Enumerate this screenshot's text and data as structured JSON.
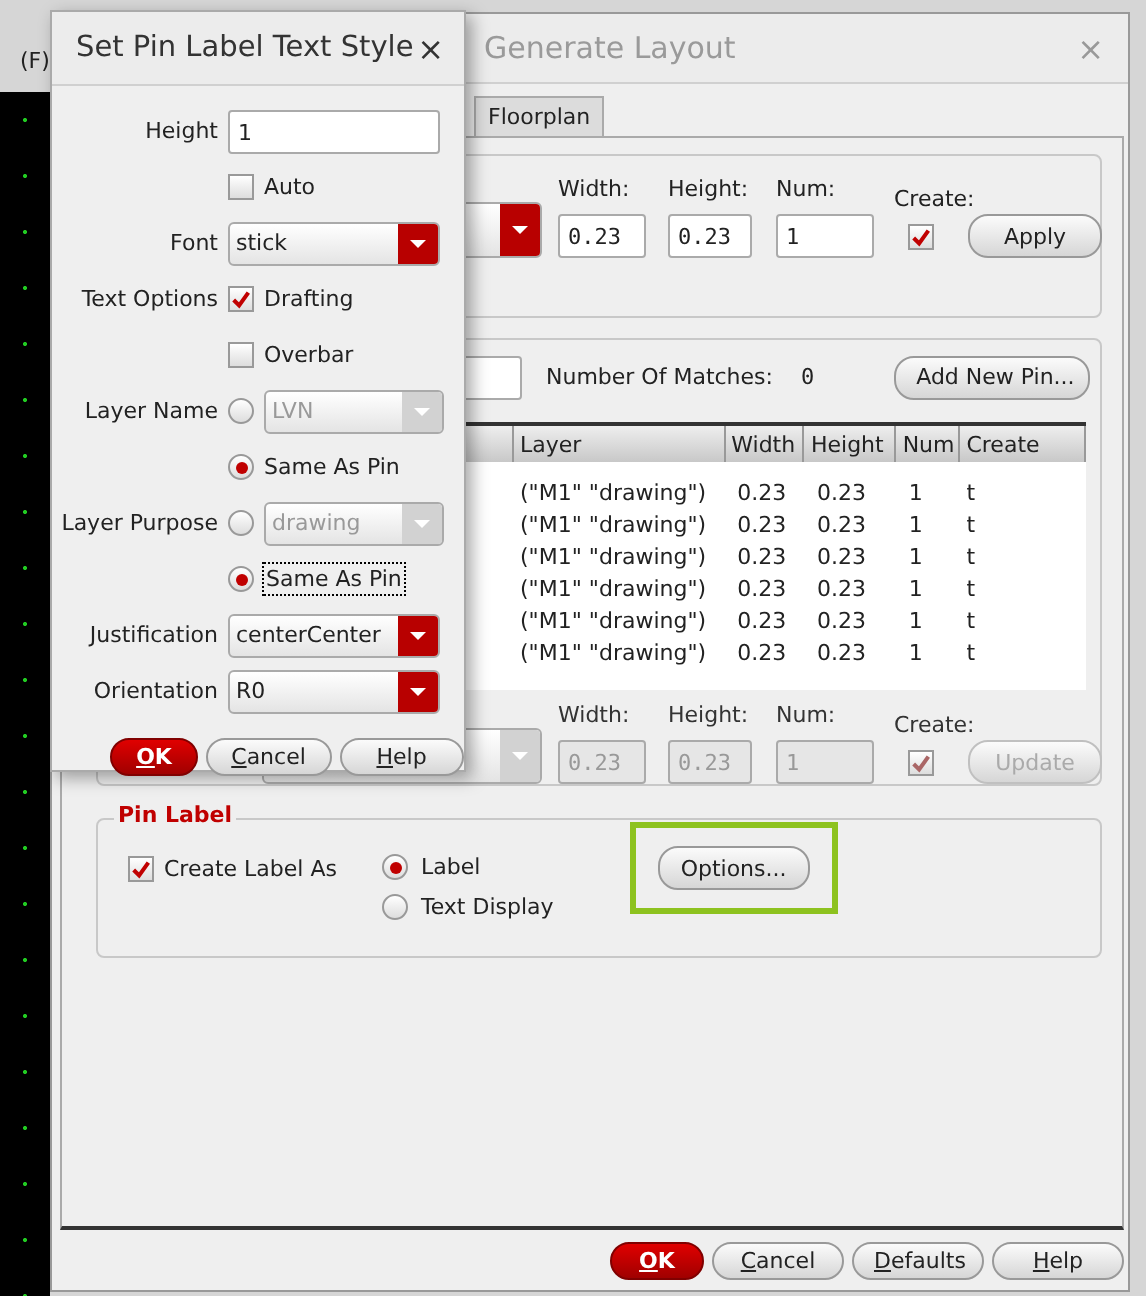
{
  "toolbar": {
    "label": "(F)"
  },
  "generate_layout": {
    "title": "Generate Layout",
    "active": false,
    "close": "×",
    "tabs": [
      {
        "label": "Floorplan",
        "selected": false
      }
    ],
    "pin_defaults": {
      "fields": [
        {
          "label": "Width:",
          "value": "0.23"
        },
        {
          "label": "Height:",
          "value": "0.23"
        },
        {
          "label": "Num:",
          "value": "1"
        }
      ],
      "create": {
        "label": "Create:",
        "checked": true
      },
      "button": "Apply"
    },
    "pin_list": {
      "matches_label": "Number Of Matches:",
      "matches": "0",
      "add_button": "Add New Pin...",
      "columns": [
        "Layer",
        "Width",
        "Height",
        "Num",
        "Create"
      ],
      "rows": [
        [
          "(\"M1\" \"drawing\")",
          "0.23",
          "0.23",
          "1",
          "t"
        ],
        [
          "(\"M1\" \"drawing\")",
          "0.23",
          "0.23",
          "1",
          "t"
        ],
        [
          "(\"M1\" \"drawing\")",
          "0.23",
          "0.23",
          "1",
          "t"
        ],
        [
          "(\"M1\" \"drawing\")",
          "0.23",
          "0.23",
          "1",
          "t"
        ],
        [
          "(\"M1\" \"drawing\")",
          "0.23",
          "0.23",
          "1",
          "t"
        ],
        [
          "(\"M1\" \"drawing\")",
          "0.23",
          "0.23",
          "1",
          "t"
        ]
      ],
      "edit": {
        "fields": [
          {
            "label": "Width:",
            "value": "0.23"
          },
          {
            "label": "Height:",
            "value": "0.23"
          },
          {
            "label": "Num:",
            "value": "1"
          }
        ],
        "create": {
          "label": "Create:",
          "checked": true
        },
        "button": "Update",
        "disabled": true
      }
    },
    "pin_label": {
      "title": "Pin Label",
      "create": {
        "label": "Create Label As",
        "checked": true
      },
      "options": [
        {
          "label": "Label",
          "selected": true
        },
        {
          "label": "Text Display",
          "selected": false
        }
      ],
      "button": {
        "label": "Options...",
        "highlighted": true
      }
    },
    "buttons": [
      {
        "label": "OK",
        "kind": "primary"
      },
      {
        "label": "Cancel",
        "kind": "normal"
      },
      {
        "label": "Defaults",
        "kind": "normal"
      },
      {
        "label": "Help",
        "kind": "normal"
      }
    ]
  },
  "text_style": {
    "title": "Set Pin Label Text Style",
    "close": "×",
    "rows": [
      {
        "kind": "field",
        "label": "Height",
        "value": "1"
      },
      {
        "kind": "check",
        "text": "Auto",
        "checked": false
      },
      {
        "kind": "select",
        "label": "Font",
        "value": "stick"
      },
      {
        "kind": "check",
        "label": "Text Options",
        "text": "Drafting",
        "checked": true
      },
      {
        "kind": "check",
        "text": "Overbar",
        "checked": false
      },
      {
        "kind": "radio_select",
        "label": "Layer Name",
        "value": "LVN",
        "selected": false,
        "disabled": true
      },
      {
        "kind": "radio",
        "text": "Same As Pin",
        "selected": true,
        "focused": false
      },
      {
        "kind": "radio_select",
        "label": "Layer Purpose",
        "value": "drawing",
        "selected": false,
        "disabled": true
      },
      {
        "kind": "radio",
        "text": "Same As Pin",
        "selected": true,
        "focused": true
      },
      {
        "kind": "select",
        "label": "Justification",
        "value": "centerCenter"
      },
      {
        "kind": "select",
        "label": "Orientation",
        "value": "R0"
      }
    ],
    "buttons": [
      {
        "label": "OK",
        "kind": "primary"
      },
      {
        "label": "Cancel",
        "kind": "normal"
      },
      {
        "label": "Help",
        "kind": "normal"
      }
    ]
  }
}
